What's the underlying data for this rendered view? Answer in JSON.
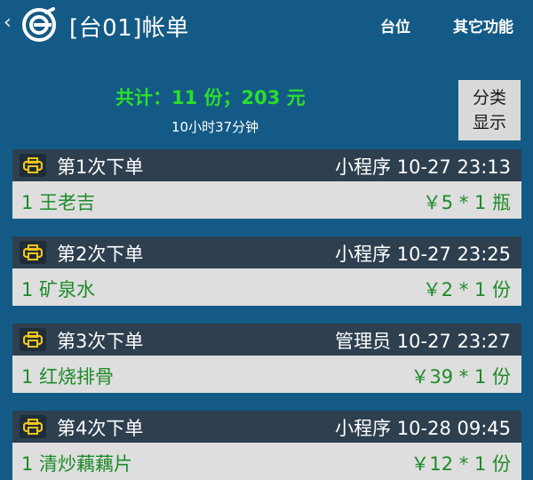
{
  "header": {
    "back_glyph": "‹",
    "title": "[台01]帐单",
    "nav_table": "台位",
    "nav_more": "其它功能"
  },
  "summary": {
    "total": "共计：11 份；203 元",
    "duration": "10小时37分钟",
    "category_btn_line1": "分类",
    "category_btn_line2": "显示"
  },
  "orders": [
    {
      "title": "第1次下单",
      "meta": "小程序 10-27 23:13",
      "item": "1 王老吉",
      "price": "￥5 * 1 瓶"
    },
    {
      "title": "第2次下单",
      "meta": "小程序 10-27 23:25",
      "item": "1 矿泉水",
      "price": "￥2 * 1 份"
    },
    {
      "title": "第3次下单",
      "meta": "管理员 10-27 23:27",
      "item": "1 红烧排骨",
      "price": "￥39 * 1 份"
    },
    {
      "title": "第4次下单",
      "meta": "小程序 10-28 09:45",
      "item": "1 清炒藕藕片",
      "price": "￥12 * 1 份"
    }
  ],
  "colors": {
    "background": "#145a86",
    "summary_green": "#2bde2b",
    "item_green": "#1f8a2a",
    "printer_yellow": "#f5c518"
  },
  "icons": {
    "back": "chevron-left-icon",
    "logo": "logo-icon",
    "printer": "printer-icon"
  }
}
